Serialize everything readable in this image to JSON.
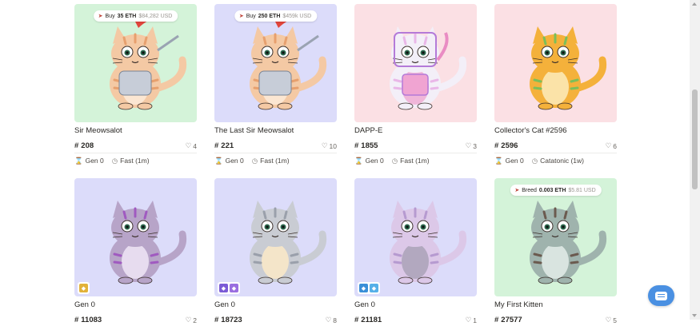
{
  "cards": [
    {
      "name": "Sir Meowsalot",
      "id": "208",
      "likes": "4",
      "gen": "Gen 0",
      "speed": "Fast (1m)",
      "bg": "#d4f3d9",
      "price": {
        "action": "Buy",
        "amount": "35 ETH",
        "usd": "$84,282 USD"
      },
      "kitty": "knight"
    },
    {
      "name": "The Last Sir Meowsalot",
      "id": "221",
      "likes": "10",
      "gen": "Gen 0",
      "speed": "Fast (1m)",
      "bg": "#dcdcfa",
      "price": {
        "action": "Buy",
        "amount": "250 ETH",
        "usd": "$459k USD"
      },
      "kitty": "knight"
    },
    {
      "name": "DAPP-E",
      "id": "1855",
      "likes": "3",
      "gen": "Gen 0",
      "speed": "Fast (1m)",
      "bg": "#fbe0e4",
      "kitty": "robot"
    },
    {
      "name": "Collector's Cat #2596",
      "id": "2596",
      "likes": "6",
      "gen": "Gen 0",
      "speed": "Catatonic (1w)",
      "bg": "#fbe0e4",
      "kitty": "orange"
    },
    {
      "name": "Gen 0",
      "id": "11083",
      "likes": "2",
      "bg": "#dcdcfa",
      "kitty": "purple",
      "badges": [
        {
          "icon": "coin-icon",
          "color": "#e2b23a"
        }
      ]
    },
    {
      "name": "Gen 0",
      "id": "18723",
      "likes": "8",
      "bg": "#dcdcfa",
      "kitty": "grey",
      "badges": [
        {
          "icon": "gem-icon",
          "color": "#7b5bd6"
        },
        {
          "icon": "gem-icon",
          "color": "#9a6ee0"
        }
      ]
    },
    {
      "name": "Gen 0",
      "id": "21181",
      "likes": "1",
      "bg": "#dcdcfa",
      "kitty": "lilac",
      "badges": [
        {
          "icon": "cube-icon",
          "color": "#3a8fd8"
        },
        {
          "icon": "cube-icon",
          "color": "#56b0e8"
        }
      ]
    },
    {
      "name": "My First Kitten",
      "id": "27577",
      "likes": "5",
      "bg": "#d4f3d9",
      "kitty": "tabby",
      "price": {
        "action": "Breed",
        "amount": "0.003 ETH",
        "usd": "$5.81 USD"
      }
    }
  ],
  "icons": {
    "like": "heart-icon",
    "id": "hash-icon",
    "gen": "hourglass-icon",
    "speed": "clock-icon",
    "chat": "chat-icon"
  },
  "colors": {
    "accent": "#4a90e2",
    "price_tag": "#c0463c"
  }
}
